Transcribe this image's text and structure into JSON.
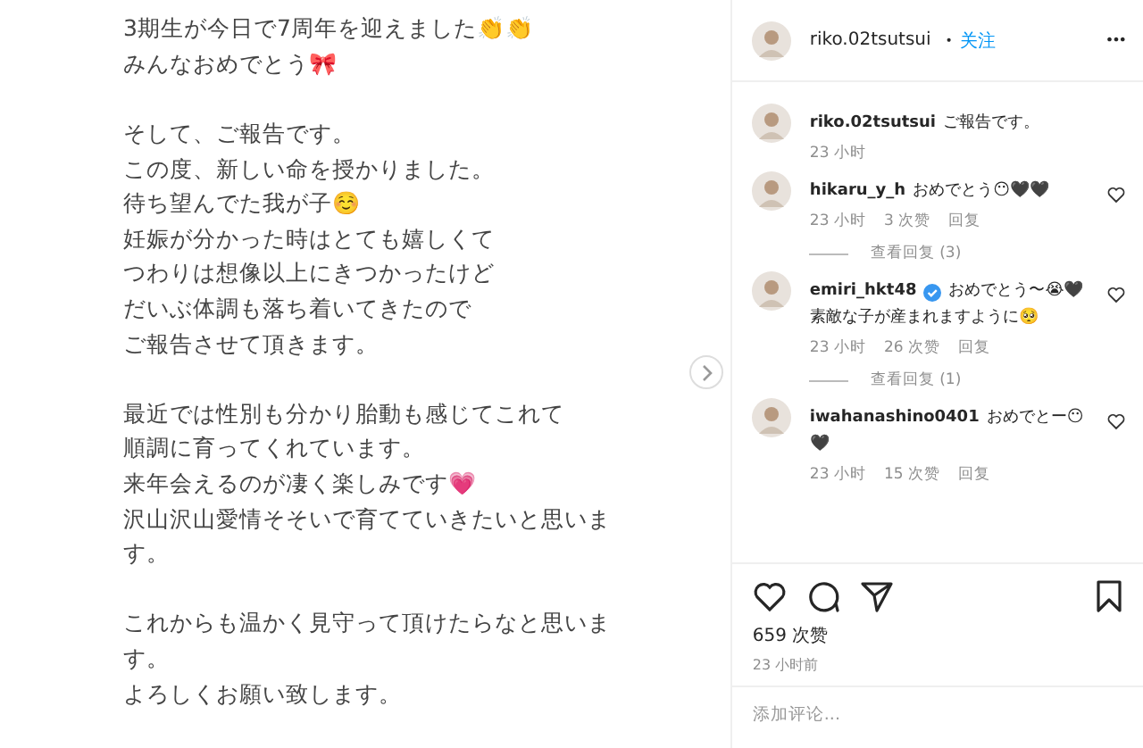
{
  "post_image": {
    "paragraphs": [
      [
        "3期生が今日で7周年を迎えました👏👏",
        "みんなおめでとう🎀"
      ],
      [
        "そして、ご報告です。",
        "この度、新しい命を授かりました。",
        "待ち望んでた我が子☺️",
        "妊娠が分かった時はとても嬉しくて",
        "つわりは想像以上にきつかったけど",
        "だいぶ体調も落ち着いてきたので",
        "ご報告させて頂きます。"
      ],
      [
        "最近では性別も分かり胎動も感じてこれて",
        "順調に育ってくれています。",
        "来年会えるのが凄く楽しみです💗",
        "沢山沢山愛情そそいで育てていきたいと思いま",
        "す。"
      ],
      [
        "これからも温かく見守って頂けたらなと思いま",
        "す。",
        "よろしくお願い致します。"
      ]
    ]
  },
  "header": {
    "username": "riko.02tsutsui",
    "separator": "•",
    "follow": "关注",
    "more": "•••"
  },
  "caption": {
    "username": "riko.02tsutsui",
    "text": "ご報告です。",
    "time": "23 小时"
  },
  "comments": [
    {
      "username": "hikaru_y_h",
      "verified": false,
      "text": "おめでとう😶🖤🖤",
      "time": "23 小时",
      "likes": "3 次赞",
      "reply": "回复",
      "view_replies": "查看回复 (3)"
    },
    {
      "username": "emiri_hkt48",
      "verified": true,
      "text": "おめでとう〜😭🖤",
      "text2": "素敵な子が産まれますように🥺",
      "time": "23 小时",
      "likes": "26 次赞",
      "reply": "回复",
      "view_replies": "查看回复 (1)"
    },
    {
      "username": "iwahanashino0401",
      "verified": false,
      "text": "おめでとー😶",
      "text2": "🖤",
      "time": "23 小时",
      "likes": "15 次赞",
      "reply": "回复"
    }
  ],
  "likes": "659 次赞",
  "posted": "23 小时前",
  "comment_box": {
    "placeholder": "添加评论..."
  }
}
